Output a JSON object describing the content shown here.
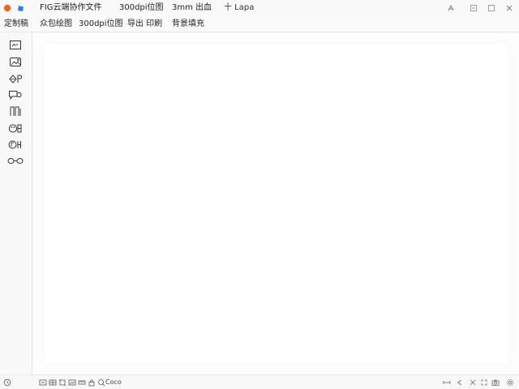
{
  "window": {
    "tabs": [
      {
        "label": "FIG云端协作文件"
      },
      {
        "label": "300dpi位图"
      },
      {
        "label": "3mm 出血"
      }
    ],
    "new_tab_label": "十 Lapa"
  },
  "menu": {
    "items": [
      {
        "label": "定制稿"
      },
      {
        "label": "众包绘图"
      },
      {
        "label": "300dpi位图"
      },
      {
        "label": "导出 印刷"
      },
      {
        "label": "背景填充"
      }
    ]
  },
  "tools": [
    {
      "icon": "image-frame-icon"
    },
    {
      "icon": "photo-card-icon"
    },
    {
      "icon": "paint-bucket-icon"
    },
    {
      "icon": "speech-bubble-icon"
    },
    {
      "icon": "columns-icon"
    },
    {
      "icon": "palette-icon"
    },
    {
      "icon": "layers-icon"
    },
    {
      "icon": "link-icon"
    }
  ],
  "statusbar": {
    "zoom_text": "Coco"
  },
  "colors": {
    "logo_orange": "#f0641e",
    "logo_blue": "#2b7de9",
    "canvas_bg": "#ffffff",
    "chrome_bg": "#f8f8f8"
  }
}
